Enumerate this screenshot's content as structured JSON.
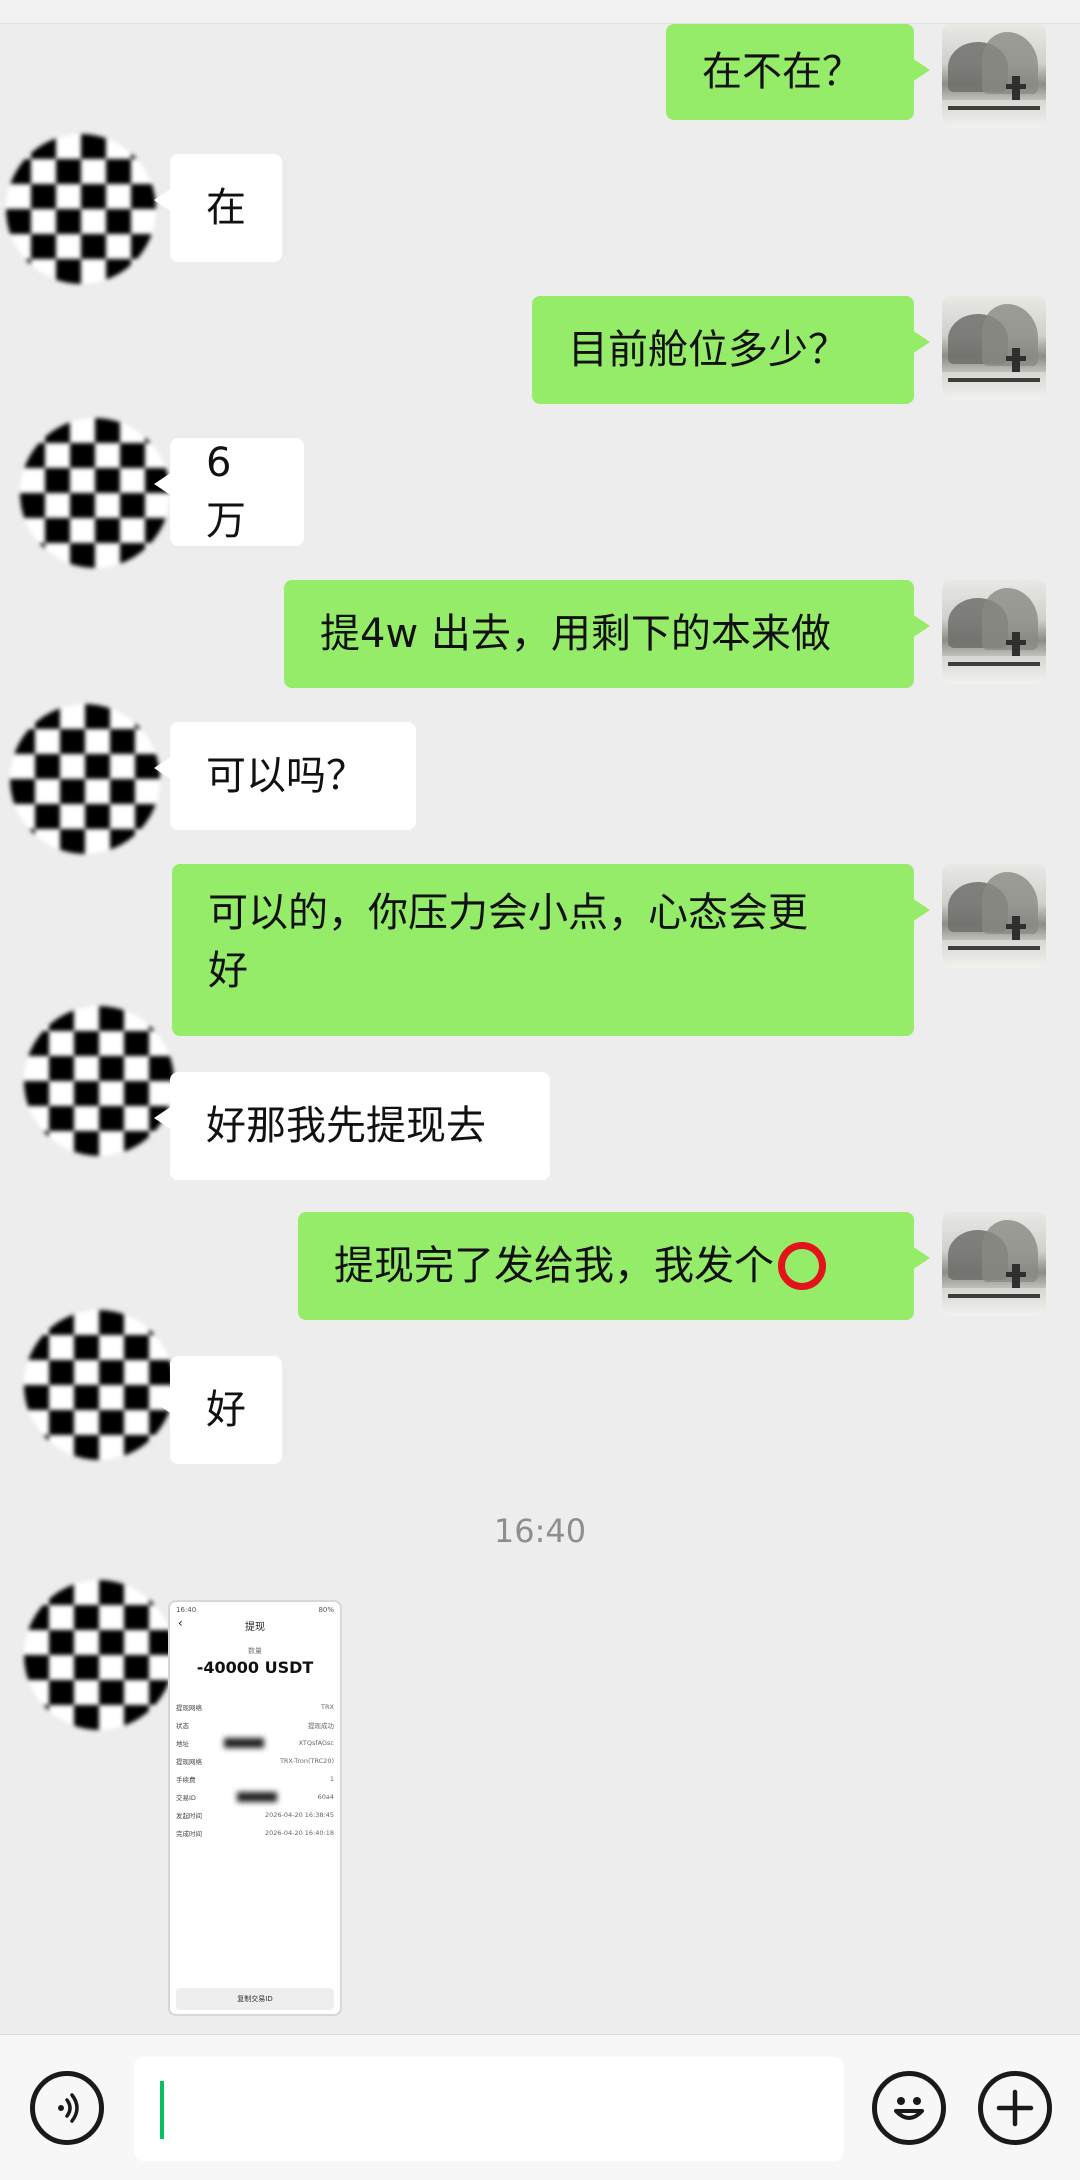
{
  "messages": [
    {
      "side": "self",
      "text": "在不在？"
    },
    {
      "side": "other",
      "text": "在"
    },
    {
      "side": "self",
      "text": "目前舱位多少？"
    },
    {
      "side": "other",
      "text": "6万"
    },
    {
      "side": "self",
      "text": "提4w 出去，用剩下的本来做"
    },
    {
      "side": "other",
      "text": "可以吗？"
    },
    {
      "side": "self",
      "line1": "可以的，你压力会小点，心态会更",
      "line2": "好"
    },
    {
      "side": "other",
      "text": "好那我先提现去"
    },
    {
      "side": "self",
      "text": "提现完了发给我，我发个"
    },
    {
      "side": "other",
      "text": "好"
    }
  ],
  "timestamp": "16:40",
  "screenshot": {
    "status_time": "16:40",
    "status_right": "80%",
    "nav_title": "提现",
    "amount_label": "数量",
    "amount": "-40000 USDT",
    "rows": [
      {
        "label": "提现网络",
        "value": "TRX"
      },
      {
        "label": "状态",
        "value": "提现成功"
      },
      {
        "label": "地址",
        "value": "XTQsfAGsc"
      },
      {
        "label": "提现网络",
        "value": "TRX-Tron(TRC20)"
      },
      {
        "label": "手续费",
        "value": "1"
      },
      {
        "label": "交易ID",
        "value": "60a4"
      },
      {
        "label": "发起时间",
        "value": "2026-04-20 16:38:45"
      },
      {
        "label": "完成时间",
        "value": "2026-04-20 16:40:18"
      }
    ],
    "copy_label": "复制交易ID"
  },
  "colors": {
    "self_bubble": "#95ec69",
    "other_bubble": "#ffffff",
    "background": "#ededed",
    "accent": "#07c160",
    "mark": "#e3121b"
  },
  "icons": {
    "voice": "voice-icon",
    "emoji": "emoji-icon",
    "plus": "plus-icon",
    "circle": "red-circle-icon"
  }
}
